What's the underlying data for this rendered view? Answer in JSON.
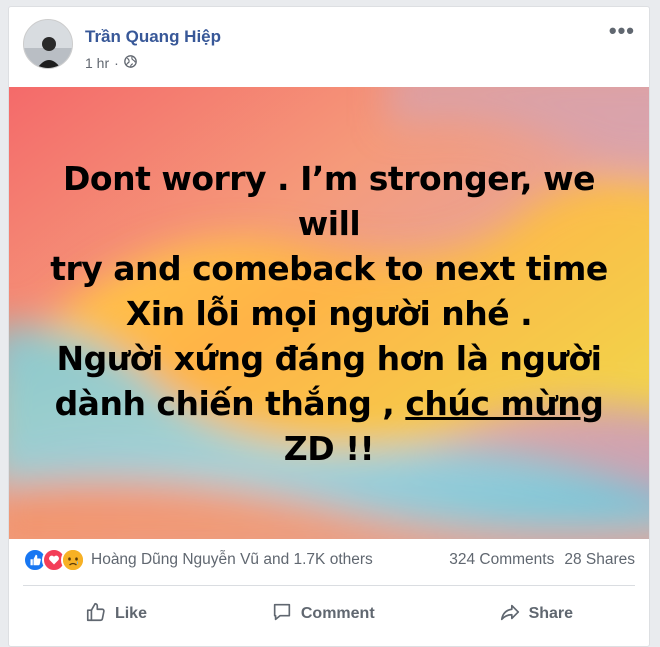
{
  "post": {
    "author": "Trần Quang Hiệp",
    "time": "1 hr",
    "audience_icon": "globe-icon",
    "more_label": "•••",
    "text_lines": [
      "Dont worry . I’m stronger, we will",
      "try and comeback to next time",
      "Xin lỗi mọi người nhé .",
      "Người xứng đáng hơn là người"
    ],
    "text_line5_prefix": "dành chiến thắng , ",
    "text_link": "chúc mừng",
    "text_line6": "ZD !!"
  },
  "stats": {
    "reaction_icons": [
      "like-icon",
      "love-icon",
      "sad-icon"
    ],
    "reactors": "Hoàng Dũng Nguyễn Vũ and 1.7K others",
    "comments": "324 Comments",
    "shares": "28 Shares"
  },
  "actions": {
    "like": "Like",
    "comment": "Comment",
    "share": "Share"
  },
  "colors": {
    "author_link": "#385898",
    "like_blue": "#1877f2",
    "love_red": "#f33e58",
    "sad_yellow": "#f7b125",
    "muted_text": "#606770"
  }
}
